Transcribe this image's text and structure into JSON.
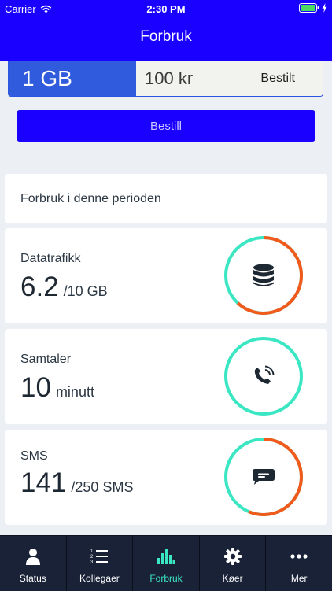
{
  "status_bar": {
    "carrier": "Carrier",
    "time": "2:30 PM"
  },
  "nav": {
    "title": "Forbruk"
  },
  "package": {
    "size": "1 GB",
    "price": "100 kr",
    "status": "Bestilt"
  },
  "order_button": "Bestill",
  "period": {
    "title": "Forbruk i denne perioden"
  },
  "usage": [
    {
      "label": "Datatrafikk",
      "value": "6.2",
      "unit": "/10 GB",
      "icon": "database-icon",
      "used_fraction": 0.62
    },
    {
      "label": "Samtaler",
      "value": "10",
      "unit": "minutt",
      "icon": "phone-icon",
      "used_fraction": 0.0
    },
    {
      "label": "SMS",
      "value": "141",
      "unit": "/250 SMS",
      "icon": "message-icon",
      "used_fraction": 0.564
    }
  ],
  "colors": {
    "brand_blue": "#1a00ff",
    "ring_remaining": "#3be6c3",
    "ring_used": "#f25a1c",
    "tabbar": "#1a2238"
  },
  "tabs": [
    {
      "label": "Status",
      "icon": "person-icon",
      "active": false
    },
    {
      "label": "Kollegaer",
      "icon": "list-icon",
      "active": false
    },
    {
      "label": "Forbruk",
      "icon": "bar-chart-icon",
      "active": true
    },
    {
      "label": "Køer",
      "icon": "gear-icon",
      "active": false
    },
    {
      "label": "Mer",
      "icon": "more-icon",
      "active": false
    }
  ]
}
